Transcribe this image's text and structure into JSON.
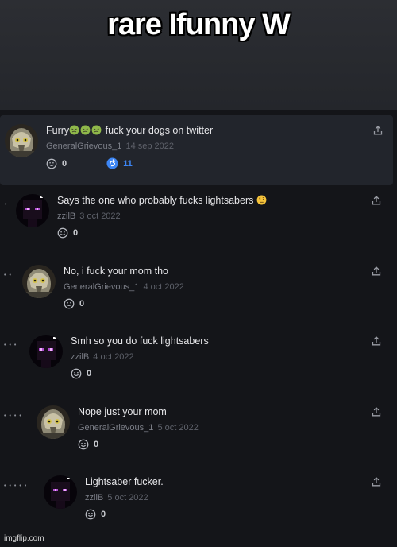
{
  "caption": "rare Ifunny W",
  "watermark": "imgflip.com",
  "comments": [
    {
      "text": "fuck your dogs on twitter",
      "text_prefix": "Furry",
      "emoji_prefix": [
        "nauseated-face",
        "nauseated-face",
        "nauseated-face"
      ],
      "user": "GeneralGrievous_1",
      "date": "14 sep 2022",
      "smiles": "0",
      "replies": "11",
      "avatar": "grievous",
      "depth": 0,
      "highlighted": true
    },
    {
      "text": "Says the one who probably fucks lightsabers",
      "emoji_suffix": "face-with-raised-eyebrow",
      "user": "zzilB",
      "date": "3 oct 2022",
      "smiles": "0",
      "avatar": "enderman",
      "depth": 1
    },
    {
      "text": "No, i fuck your mom tho",
      "user": "GeneralGrievous_1",
      "date": "4 oct 2022",
      "smiles": "0",
      "avatar": "grievous",
      "depth": 2
    },
    {
      "text": "Smh so you do fuck lightsabers",
      "user": "zzilB",
      "date": "4 oct 2022",
      "smiles": "0",
      "avatar": "enderman",
      "depth": 3
    },
    {
      "text": "Nope just your mom",
      "user": "GeneralGrievous_1",
      "date": "5 oct 2022",
      "smiles": "0",
      "avatar": "grievous",
      "depth": 4
    },
    {
      "text": "Lightsaber fucker.",
      "user": "zzilB",
      "date": "5 oct 2022",
      "smiles": "0",
      "avatar": "enderman",
      "depth": 5
    }
  ],
  "colors": {
    "reply_accent": "#3d86f5",
    "background": "#141519",
    "highlight": "#22252c"
  }
}
